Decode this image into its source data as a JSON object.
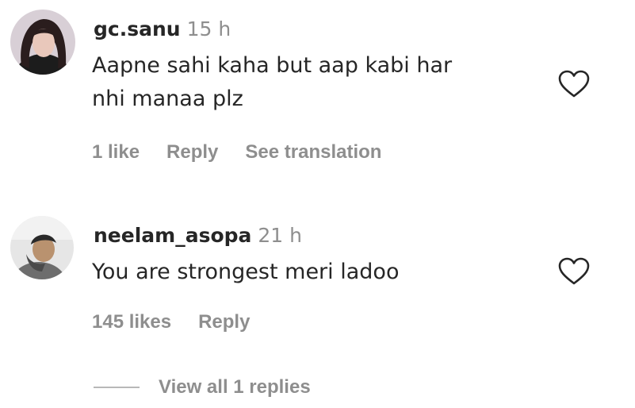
{
  "comments": [
    {
      "username": "gc.sanu",
      "timestamp": "15 h",
      "text_line1": "Aapne sahi kaha but aap kabi har",
      "text_line2": "nhi manaa plz",
      "likes": "1 like",
      "reply_label": "Reply",
      "translate_label": "See translation",
      "avatar_icon": "profile-photo-icon",
      "like_icon": "heart-outline-icon"
    },
    {
      "username": "neelam_asopa",
      "timestamp": "21 h",
      "text_line1": "You are strongest meri ladoo",
      "likes": "145 likes",
      "reply_label": "Reply",
      "avatar_icon": "profile-photo-icon",
      "like_icon": "heart-outline-icon"
    }
  ],
  "view_replies_label": "View all 1 replies",
  "colors": {
    "primary_text": "#262626",
    "secondary_text": "#8e8e8e"
  }
}
